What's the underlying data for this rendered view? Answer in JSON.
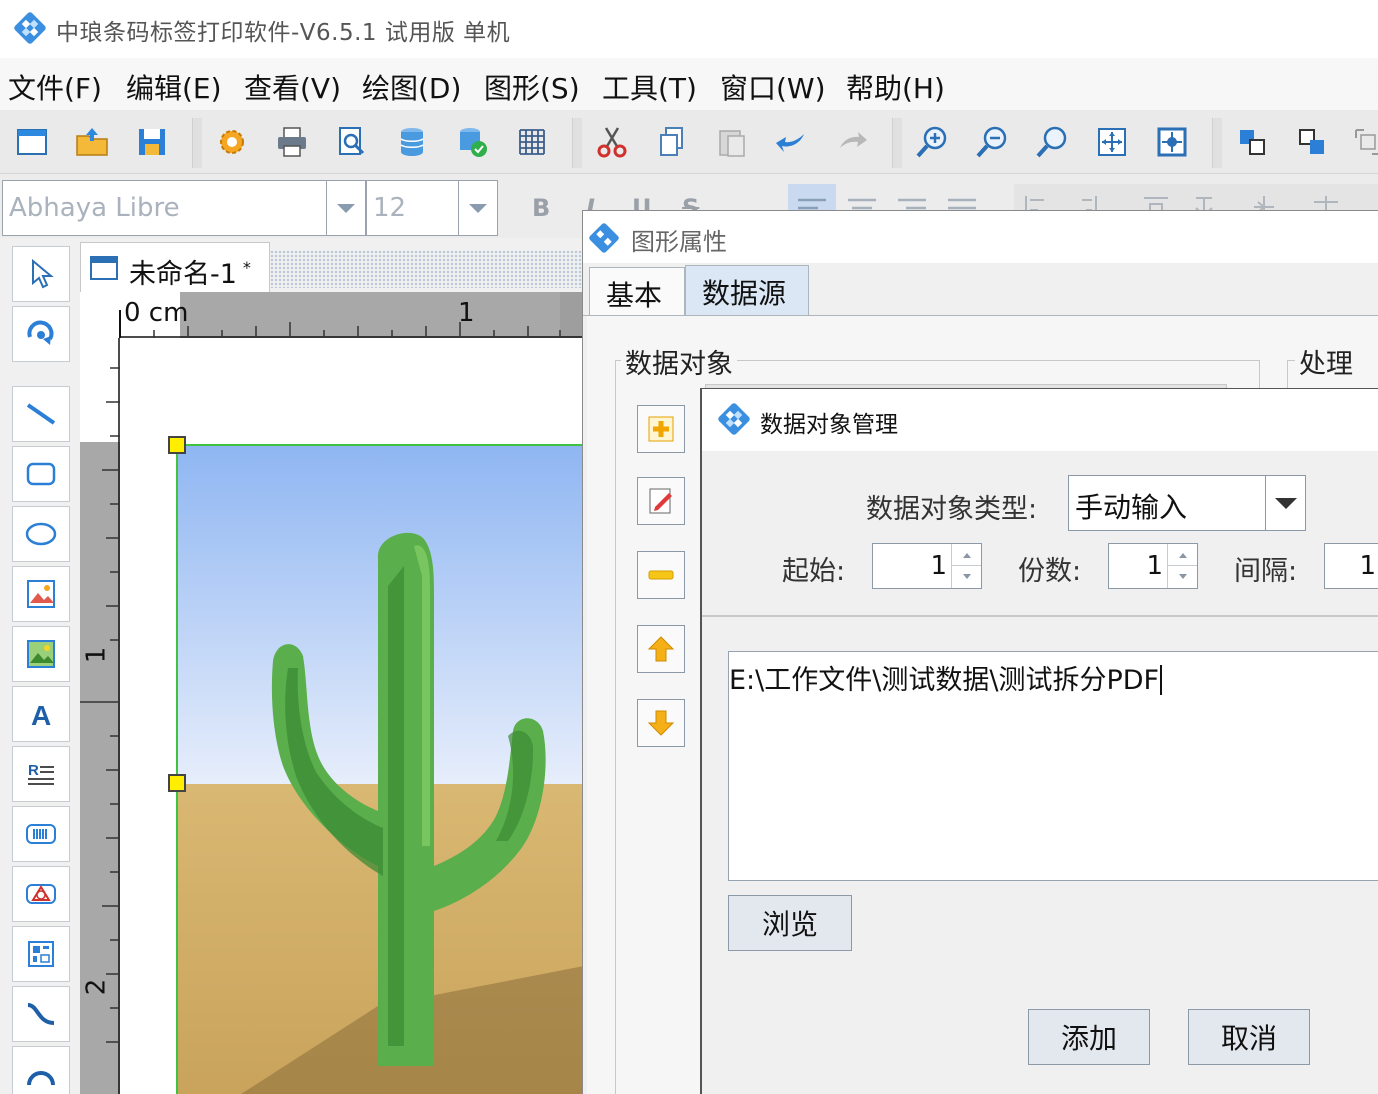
{
  "window": {
    "title": "中琅条码标签打印软件-V6.5.1 试用版 单机"
  },
  "menu": [
    "文件(F)",
    "编辑(E)",
    "查看(V)",
    "绘图(D)",
    "图形(S)",
    "工具(T)",
    "窗口(W)",
    "帮助(H)"
  ],
  "toolbar": {
    "icons": [
      "new-icon",
      "open-icon",
      "save-icon",
      "settings-icon",
      "print-icon",
      "print-preview-icon",
      "database-icon",
      "database-settings-icon",
      "grid-icon",
      "cut-icon",
      "copy-icon",
      "paste-icon",
      "undo-icon",
      "redo-icon",
      "zoom-in-icon",
      "zoom-out-icon",
      "zoom-icon",
      "fit-page-icon",
      "fit-width-icon",
      "bring-front-icon",
      "send-back-icon",
      "group-icon"
    ]
  },
  "format": {
    "font": "Abhaya Libre",
    "size": "12",
    "bold": "B",
    "italic": "I",
    "underline": "U",
    "strike": "S"
  },
  "toolbox": [
    "select-tool",
    "rotate-tool",
    "line-tool",
    "rectangle-tool",
    "ellipse-tool",
    "image-tool",
    "picture-tool",
    "text-tool",
    "richtext-tool",
    "barcode-tool",
    "shape-tool",
    "qrcode-tool",
    "curve-tool",
    "arc-tool"
  ],
  "document": {
    "title": "未命名-1",
    "modified": "*"
  },
  "ruler": {
    "h_zero": "0 cm",
    "h_one": "1",
    "v_one": "1",
    "v_two": "2"
  },
  "props_dialog": {
    "title": "图形属性",
    "tabs": [
      "基本",
      "数据源"
    ],
    "active_tab": "数据源",
    "group_data_objects": "数据对象",
    "group_processing": "处理方"
  },
  "manager_dialog": {
    "title": "数据对象管理",
    "type_label": "数据对象类型:",
    "type_value": "手动输入",
    "start_label": "起始:",
    "start_value": "1",
    "copies_label": "份数:",
    "copies_value": "1",
    "interval_label": "间隔:",
    "interval_value": "1",
    "text_value": "E:\\工作文件\\测试数据\\测试拆分PDF",
    "browse_label": "浏览",
    "add_label": "添加",
    "cancel_label": "取消"
  },
  "colors": {
    "accent": "#1e7fd8",
    "selection": "#3fc23f",
    "handle": "#ffee00",
    "active_tab": "#dbe7f5"
  }
}
